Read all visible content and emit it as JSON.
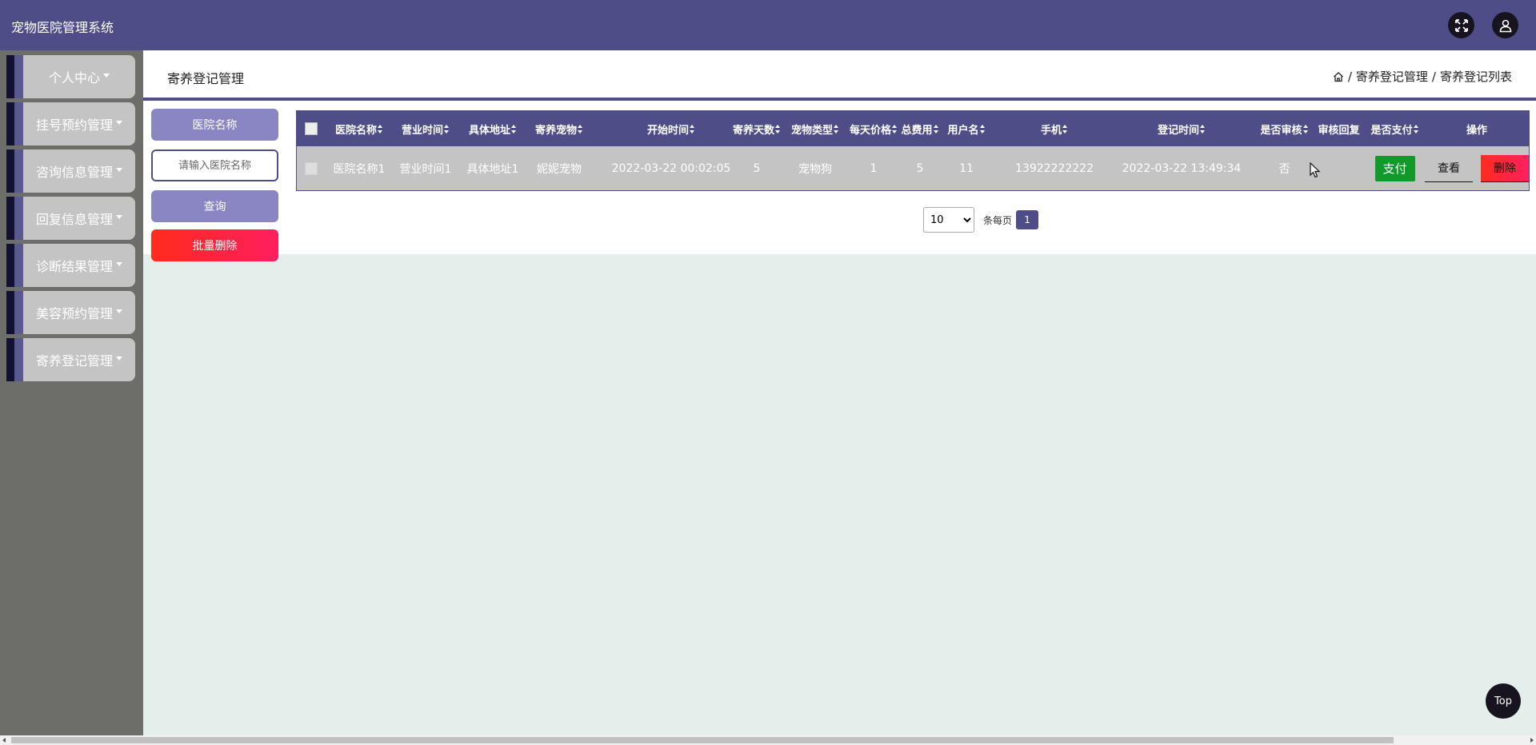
{
  "app": {
    "title": "宠物医院管理系统"
  },
  "topbar": {
    "fullscreen_icon": "fullscreen-icon",
    "user_icon": "user-icon"
  },
  "sidebar": {
    "items": [
      {
        "label": "个人中心"
      },
      {
        "label": "挂号预约管理"
      },
      {
        "label": "咨询信息管理"
      },
      {
        "label": "回复信息管理"
      },
      {
        "label": "诊断结果管理"
      },
      {
        "label": "美容预约管理"
      },
      {
        "label": "寄养登记管理"
      }
    ]
  },
  "header": {
    "title": "寄养登记管理",
    "breadcrumb": {
      "home_icon": "home-icon",
      "sep": "/",
      "level1": "寄养登记管理",
      "level2": "寄养登记列表"
    }
  },
  "search": {
    "field_label": "医院名称",
    "input_placeholder": "请输入医院名称",
    "input_value": "",
    "query_label": "查询",
    "batch_delete_label": "批量删除"
  },
  "table": {
    "columns": [
      {
        "label": "医院名称",
        "sortable": true
      },
      {
        "label": "营业时间",
        "sortable": true
      },
      {
        "label": "具体地址",
        "sortable": true
      },
      {
        "label": "寄养宠物",
        "sortable": true
      },
      {
        "label": "开始时间",
        "sortable": true
      },
      {
        "label": "寄养天数",
        "sortable": true
      },
      {
        "label": "宠物类型",
        "sortable": true
      },
      {
        "label": "每天价格",
        "sortable": true
      },
      {
        "label": "总费用",
        "sortable": true
      },
      {
        "label": "用户名",
        "sortable": true
      },
      {
        "label": "手机",
        "sortable": true
      },
      {
        "label": "登记时间",
        "sortable": true
      },
      {
        "label": "是否审核",
        "sortable": true
      },
      {
        "label": "审核回复",
        "sortable": false
      },
      {
        "label": "是否支付",
        "sortable": true
      },
      {
        "label": "操作",
        "sortable": false
      }
    ],
    "rows": [
      {
        "hospital": "医院名称1",
        "hours": "营业时间1",
        "address": "具体地址1",
        "pet": "妮妮宠物",
        "start_time": "2022-03-22 00:02:05",
        "days": "5",
        "pet_type": "宠物狗",
        "daily_price": "1",
        "total": "5",
        "username": "11",
        "phone": "13922222222",
        "register_time": "2022-03-22 13:49:34",
        "reviewed": "否",
        "review_reply": "",
        "pay_label": "支付",
        "view_label": "查看",
        "delete_label": "删除"
      }
    ]
  },
  "pagination": {
    "page_size_options": [
      "10"
    ],
    "page_size": "10",
    "per_page_label": "条每页",
    "current_page": "1"
  },
  "back_to_top": {
    "label": "Top"
  },
  "colors": {
    "primary": "#4f4d87",
    "sidebar_bg": "#6d6d69",
    "menu_bg": "#c4c4c4",
    "accent_light": "#8a86c4",
    "danger": "#ff2b1c",
    "success": "#109a2a",
    "content_bg": "#e4efeb"
  }
}
